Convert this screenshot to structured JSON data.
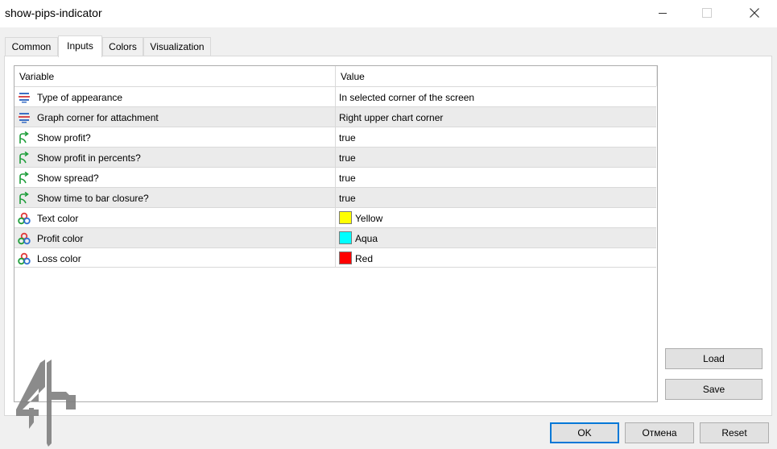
{
  "window": {
    "title": "show-pips-indicator"
  },
  "tabs": [
    {
      "label": "Common"
    },
    {
      "label": "Inputs"
    },
    {
      "label": "Colors"
    },
    {
      "label": "Visualization"
    }
  ],
  "grid": {
    "headers": {
      "variable": "Variable",
      "value": "Value"
    },
    "rows": [
      {
        "icon": "enum-icon",
        "variable": "Type of appearance",
        "value": "In selected corner of the screen"
      },
      {
        "icon": "enum-icon",
        "variable": "Graph corner for attachment",
        "value": "Right upper chart corner"
      },
      {
        "icon": "bool-icon",
        "variable": "Show profit?",
        "value": "true"
      },
      {
        "icon": "bool-icon",
        "variable": "Show profit in percents?",
        "value": "true"
      },
      {
        "icon": "bool-icon",
        "variable": "Show spread?",
        "value": "true"
      },
      {
        "icon": "bool-icon",
        "variable": "Show time to bar closure?",
        "value": "true"
      },
      {
        "icon": "color-icon",
        "variable": "Text color",
        "value": "Yellow",
        "swatch": "#ffff00"
      },
      {
        "icon": "color-icon",
        "variable": "Profit color",
        "value": "Aqua",
        "swatch": "#00ffff"
      },
      {
        "icon": "color-icon",
        "variable": "Loss color",
        "value": "Red",
        "swatch": "#ff0000"
      }
    ]
  },
  "side_buttons": {
    "load": "Load",
    "save": "Save"
  },
  "footer_buttons": {
    "ok": "OK",
    "cancel": "Отмена",
    "reset": "Reset"
  },
  "colors": {
    "accent": "#0078d7",
    "row_alt": "#ebebeb"
  }
}
